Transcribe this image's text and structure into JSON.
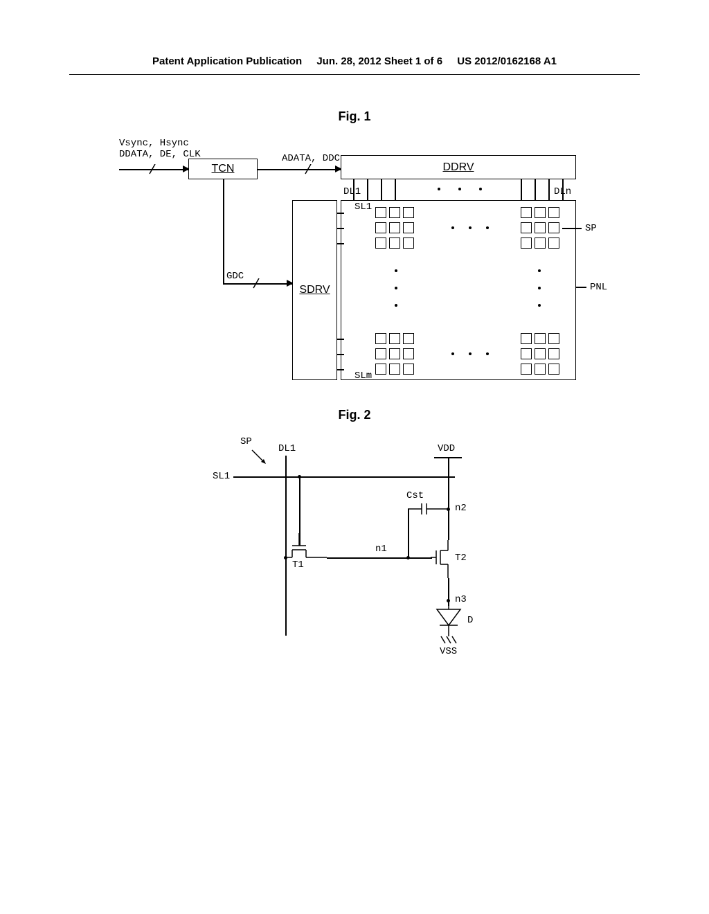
{
  "header": {
    "left": "Patent Application Publication",
    "center": "Jun. 28, 2012  Sheet 1 of 6",
    "right": "US 2012/0162168 A1"
  },
  "fig1": {
    "title": "Fig. 1",
    "signals": "Vsync, Hsync\nDDATA, DE, CLK",
    "tcn": "TCN",
    "adata": "ADATA, DDC",
    "ddrv": "DDRV",
    "dl1": "DL1",
    "dln": "DLn",
    "sl1": "SL1",
    "slm": "SLm",
    "gdc": "GDC",
    "sdrv": "SDRV",
    "sp": "SP",
    "pnl": "PNL"
  },
  "fig2": {
    "title": "Fig. 2",
    "sp": "SP",
    "dl1": "DL1",
    "sl1": "SL1",
    "vdd": "VDD",
    "cst": "Cst",
    "t1": "T1",
    "n1": "n1",
    "t2": "T2",
    "n2": "n2",
    "n3": "n3",
    "d": "D",
    "vss": "VSS"
  }
}
